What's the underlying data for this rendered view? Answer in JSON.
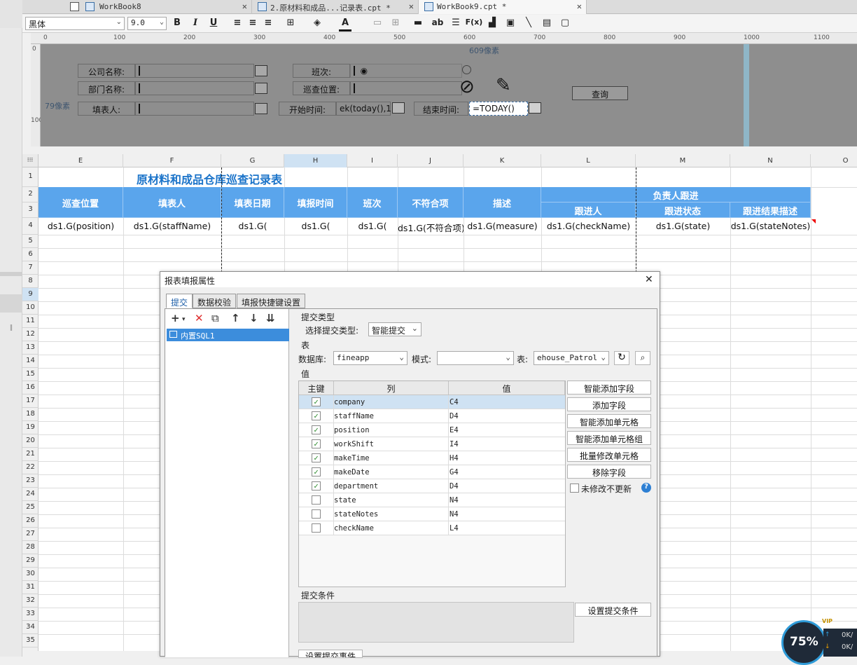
{
  "tabs": [
    {
      "label": "WorkBook8",
      "active": false
    },
    {
      "label": "2.原材料和成品...记录表.cpt *",
      "active": false
    },
    {
      "label": "WorkBook9.cpt *",
      "active": true
    }
  ],
  "toolbar": {
    "font_name": "黑体",
    "font_size": "9.0",
    "bold": "B",
    "italic": "I",
    "underline": "U",
    "text_color": "A",
    "wrap_label": "ab",
    "formula_label": "F(x)"
  },
  "ruler": {
    "ticks": [
      "0",
      "100",
      "200",
      "300",
      "400",
      "500",
      "600",
      "700",
      "800",
      "900",
      "1000",
      "1100"
    ],
    "vticks": [
      "0",
      "100"
    ]
  },
  "params": {
    "width_hint": "609像素",
    "height_hint": "79像素",
    "company_label": "公司名称:",
    "department_label": "部门名称:",
    "filler_label": "填表人:",
    "shift_label": "班次:",
    "patrol_label": "巡查位置:",
    "start_label": "开始时间:",
    "start_value": "ek(today(),1)",
    "end_label": "结束时间:",
    "end_value": "=TODAY()",
    "query_button": "查询"
  },
  "sheet": {
    "columns": [
      "E",
      "F",
      "G",
      "H",
      "I",
      "J",
      "K",
      "L",
      "M",
      "N",
      "O"
    ],
    "rows": [
      "1",
      "2",
      "3",
      "4",
      "5",
      "6",
      "7",
      "8",
      "9",
      "10",
      "11",
      "12",
      "13",
      "14",
      "15",
      "16",
      "17",
      "18",
      "19",
      "20",
      "21",
      "22",
      "23",
      "24",
      "25",
      "26",
      "27",
      "28",
      "29",
      "30",
      "31",
      "32",
      "33",
      "34",
      "35"
    ],
    "title": "原材料和成品仓库巡查记录表",
    "headers": {
      "position": "巡查位置",
      "filler": "填表人",
      "fill_date": "填表日期",
      "fill_time": "填报时间",
      "shift": "班次",
      "nonconform": "不符合项",
      "describe": "描述",
      "owner_follow": "负责人跟进",
      "follower": "跟进人",
      "follow_status": "跟进状态",
      "follow_desc": "跟进结果描述"
    },
    "cells": {
      "e4": "ds1.G(position)",
      "f4": "ds1.G(staffName)",
      "g4": "ds1.G(",
      "h4": "ds1.G(",
      "i4": "ds1.G(",
      "j4": "ds1.G(不符合项)",
      "k4": "ds1.G(measure)",
      "l4": "ds1.G(checkName)",
      "m4": "ds1.G(state)",
      "n4": "ds1.G(stateNotes)"
    },
    "header_color": "#5aa5ec",
    "title_color": "#1a73c9"
  },
  "dialog": {
    "title": "报表填报属性",
    "tabs": [
      "提交",
      "数据校验",
      "填报快捷键设置"
    ],
    "sql_item": "内置SQL1",
    "submit_type_section": "提交类型",
    "select_type_label": "选择提交类型:",
    "select_type_value": "智能提交",
    "table_section": "表",
    "db_label": "数据库:",
    "db_value": "fineapp",
    "schema_label": "模式:",
    "schema_value": "",
    "table_label": "表:",
    "table_value": "ehouse_Patrol",
    "value_section": "值",
    "col_pk": "主键",
    "col_column": "列",
    "col_value": "值",
    "rows": [
      {
        "column": "company",
        "value": "C4",
        "checked": true
      },
      {
        "column": "staffName",
        "value": "D4",
        "checked": true
      },
      {
        "column": "position",
        "value": "E4",
        "checked": true
      },
      {
        "column": "workShift",
        "value": "I4",
        "checked": true
      },
      {
        "column": "makeTime",
        "value": "H4",
        "checked": true
      },
      {
        "column": "makeDate",
        "value": "G4",
        "checked": true
      },
      {
        "column": "department",
        "value": "D4",
        "checked": true
      },
      {
        "column": "state",
        "value": "N4",
        "checked": false
      },
      {
        "column": "stateNotes",
        "value": "N4",
        "checked": false
      },
      {
        "column": "checkName",
        "value": "L4",
        "checked": false
      }
    ],
    "buttons": {
      "smart_add_field": "智能添加字段",
      "add_field": "添加字段",
      "smart_add_cell": "智能添加单元格",
      "smart_add_cell_group": "智能添加单元格组",
      "batch_modify_cell": "批量修改单元格",
      "remove_field": "移除字段",
      "no_update_unmodified": "未修改不更新",
      "set_submit_condition": "设置提交条件",
      "set_submit_event": "设置提交事件"
    },
    "submit_condition_section": "提交条件"
  },
  "overlay": {
    "cpu": "75%",
    "net_up": "0K/",
    "net_down": "0K/",
    "badge": "VIP"
  }
}
